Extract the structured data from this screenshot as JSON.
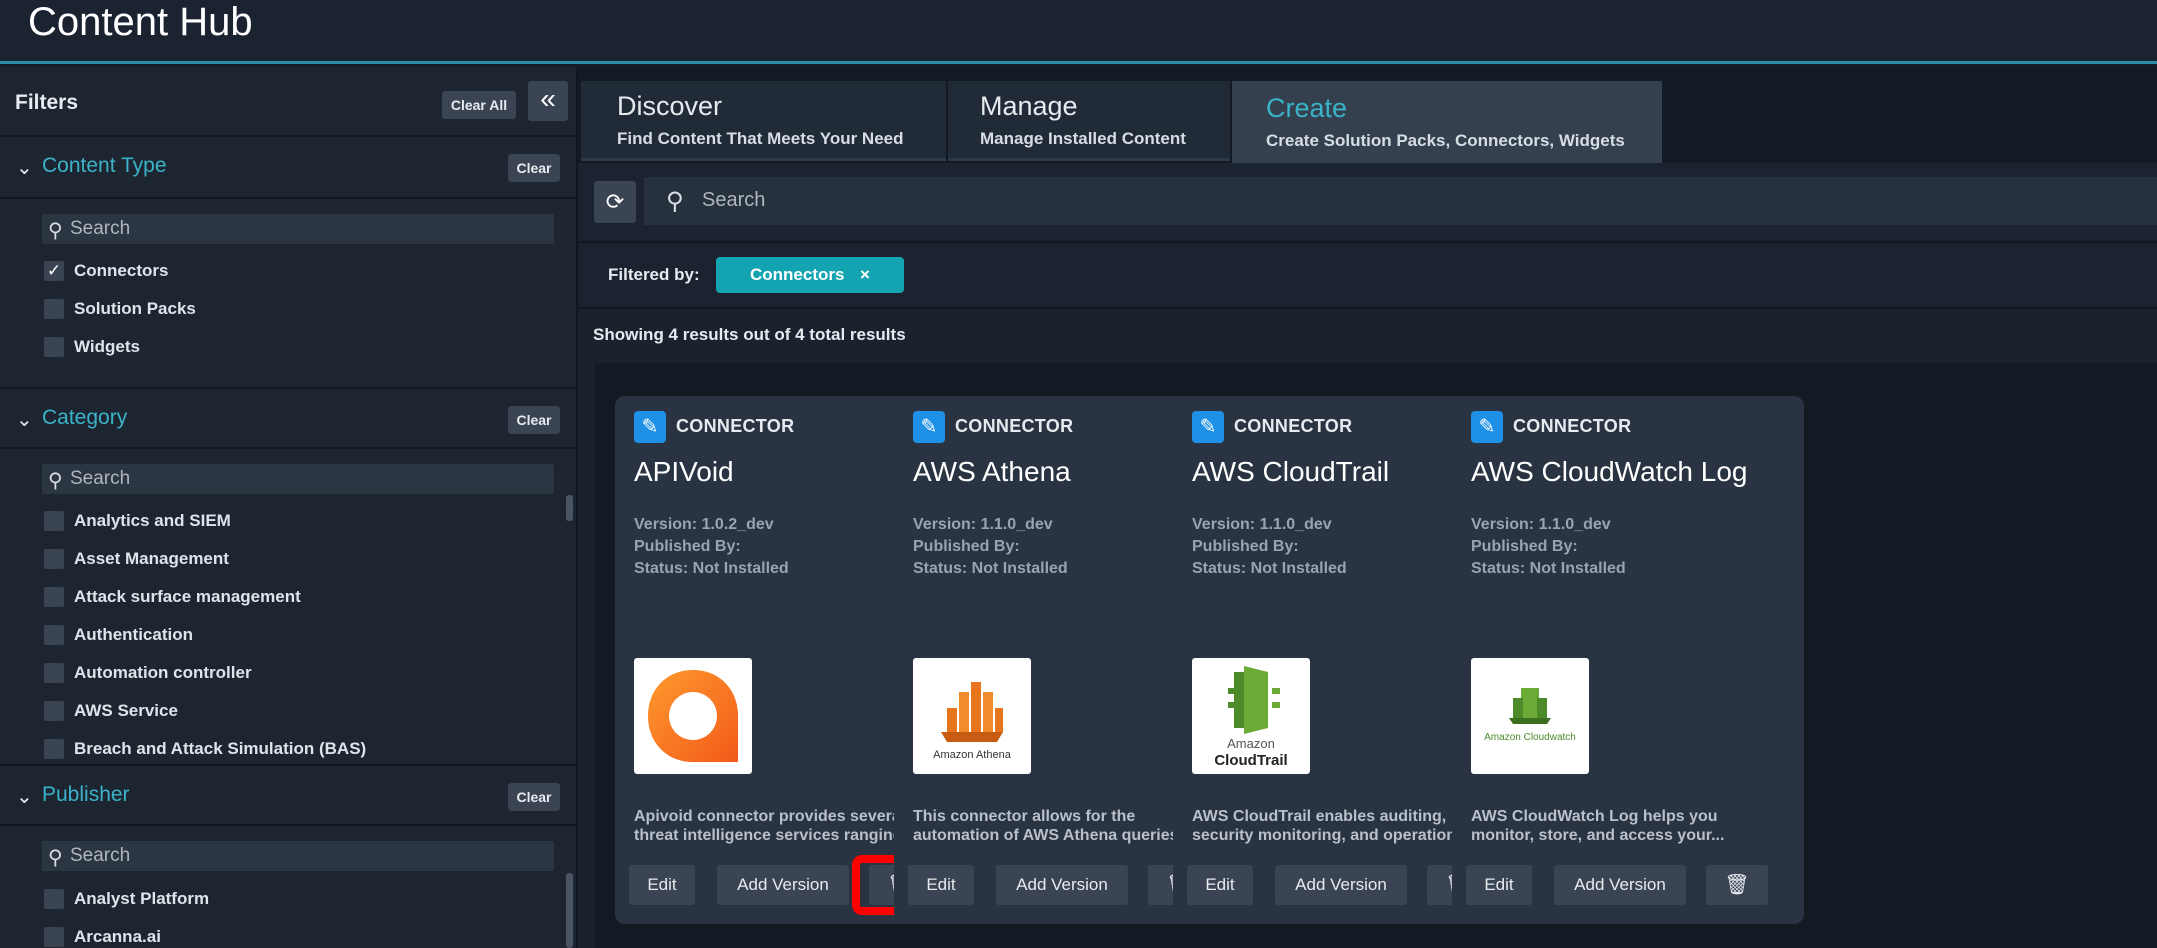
{
  "app": {
    "title": "Content Hub"
  },
  "sidebar": {
    "title": "Filters",
    "clear_all_label": "Clear All",
    "collapse_icon": "double-chevron-left-icon",
    "sections": {
      "content_type": {
        "label": "Content Type",
        "clear_label": "Clear",
        "search_placeholder": "Search",
        "items": [
          {
            "label": "Connectors",
            "checked": true
          },
          {
            "label": "Solution Packs",
            "checked": false
          },
          {
            "label": "Widgets",
            "checked": false
          }
        ]
      },
      "category": {
        "label": "Category",
        "clear_label": "Clear",
        "search_placeholder": "Search",
        "items": [
          {
            "label": "Analytics and SIEM"
          },
          {
            "label": "Asset Management"
          },
          {
            "label": "Attack surface management"
          },
          {
            "label": "Authentication"
          },
          {
            "label": "Automation controller"
          },
          {
            "label": "AWS Service"
          },
          {
            "label": "Breach and Attack Simulation (BAS)"
          }
        ]
      },
      "publisher": {
        "label": "Publisher",
        "clear_label": "Clear",
        "search_placeholder": "Search",
        "items": [
          {
            "label": "Analyst Platform"
          },
          {
            "label": "Arcanna.ai"
          }
        ]
      }
    }
  },
  "tabs": [
    {
      "title": "Discover",
      "subtitle": "Find Content That Meets Your Need"
    },
    {
      "title": "Manage",
      "subtitle": "Manage Installed Content"
    },
    {
      "title": "Create",
      "subtitle": "Create Solution Packs, Connectors, Widgets"
    }
  ],
  "active_tab": "Create",
  "search": {
    "placeholder": "Search"
  },
  "filter_bar": {
    "label": "Filtered by:",
    "chip": "Connectors",
    "chip_remove": "×"
  },
  "results_text": "Showing 4 results out of 4 total results",
  "cards": [
    {
      "type": "CONNECTOR",
      "name": "APIVoid",
      "version": "Version: 1.0.2_dev",
      "published_by": "Published By:",
      "status": "Status: Not Installed",
      "desc_line1": "Apivoid connector provides several",
      "desc_line2": "threat intelligence services ranging...",
      "edit": "Edit",
      "add_version": "Add Version"
    },
    {
      "type": "CONNECTOR",
      "name": "AWS Athena",
      "version": "Version: 1.1.0_dev",
      "published_by": "Published By:",
      "status": "Status: Not Installed",
      "logo_text": "Amazon Athena",
      "desc_line1": "This connector allows for the",
      "desc_line2": "automation of AWS Athena queries",
      "edit": "Edit",
      "add_version": "Add Version"
    },
    {
      "type": "CONNECTOR",
      "name": "AWS CloudTrail",
      "version": "Version: 1.1.0_dev",
      "published_by": "Published By:",
      "status": "Status: Not Installed",
      "logo_text_1": "Amazon",
      "logo_text_2": "CloudTrail",
      "desc_line1": "AWS CloudTrail enables auditing,",
      "desc_line2": "security monitoring, and operationa...",
      "edit": "Edit",
      "add_version": "Add Version"
    },
    {
      "type": "CONNECTOR",
      "name": "AWS CloudWatch Log",
      "version": "Version: 1.1.0_dev",
      "published_by": "Published By:",
      "status": "Status: Not Installed",
      "logo_text": "Amazon Cloudwatch",
      "desc_line1": "AWS CloudWatch Log helps you",
      "desc_line2": "monitor, store, and access your...",
      "edit": "Edit",
      "add_version": "Add Version"
    }
  ],
  "colors": {
    "accent": "#3ab3c8",
    "chip": "#14a3b0",
    "highlight": "#ff0000",
    "connector_icon": "#1e90e6"
  }
}
